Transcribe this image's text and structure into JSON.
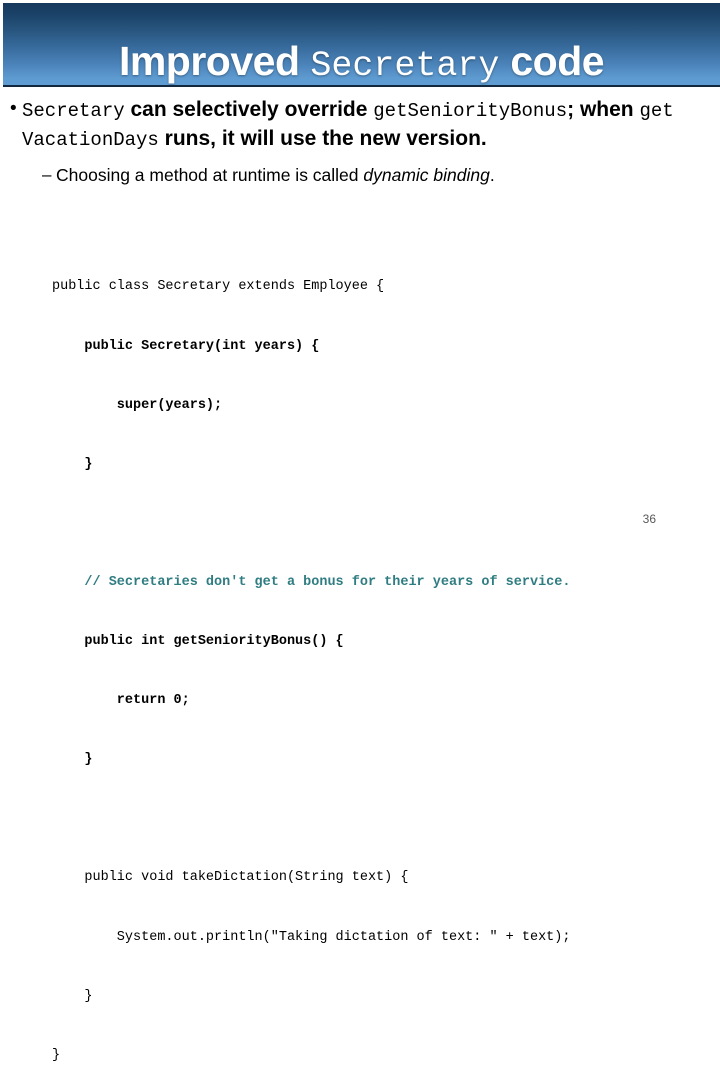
{
  "slide": {
    "title": {
      "part1": "Improved",
      "part2": "Secretary",
      "part3": "code"
    },
    "bullets": [
      {
        "marker": "•",
        "segments": [
          {
            "style": "mono",
            "text": "Secretary"
          },
          {
            "style": "bold",
            "text": " can selectively override "
          },
          {
            "style": "mono",
            "text": "get​Seniority​Bonus"
          },
          {
            "style": "bold",
            "text": "; when "
          },
          {
            "style": "mono",
            "text": "get​Vacation​Days"
          },
          {
            "style": "bold",
            "text": " runs, it will use the new version."
          }
        ]
      }
    ],
    "subbullets": [
      {
        "marker": "–",
        "segments": [
          {
            "style": "normal",
            "text": "Choosing a method at runtime is called "
          },
          {
            "style": "italic",
            "text": "dynamic binding"
          },
          {
            "style": "normal",
            "text": "."
          }
        ]
      }
    ],
    "code": {
      "language": "java",
      "comment_color": "#2f7d82",
      "lines": [
        {
          "text": "public class Secretary extends Employee {",
          "bold": false
        },
        {
          "text": "    public Secretary(int years) {",
          "bold": true
        },
        {
          "text": "        super(years);",
          "bold": true
        },
        {
          "text": "    }",
          "bold": true
        },
        {
          "text": "",
          "bold": false
        },
        {
          "text": "    // Secretaries don't get a bonus for their years of service.",
          "bold": true,
          "comment": true
        },
        {
          "text": "    public int getSeniorityBonus() {",
          "bold": true
        },
        {
          "text": "        return 0;",
          "bold": true
        },
        {
          "text": "    }",
          "bold": true
        },
        {
          "text": "",
          "bold": false
        },
        {
          "text": "    public void takeDictation(String text) {",
          "bold": false
        },
        {
          "text": "        System.out.println(\"Taking dictation of text: \" + text);",
          "bold": false
        },
        {
          "text": "    }",
          "bold": false
        },
        {
          "text": "}",
          "bold": false
        }
      ]
    },
    "slide_number": "36",
    "colors": {
      "banner_top": "#15395c",
      "banner_bottom": "#5f9cd2",
      "banner_rule": "#11283f",
      "title_text": "#ffffff",
      "body_text": "#000000",
      "comment": "#2f7d82",
      "slide_number": "#59595b"
    }
  }
}
